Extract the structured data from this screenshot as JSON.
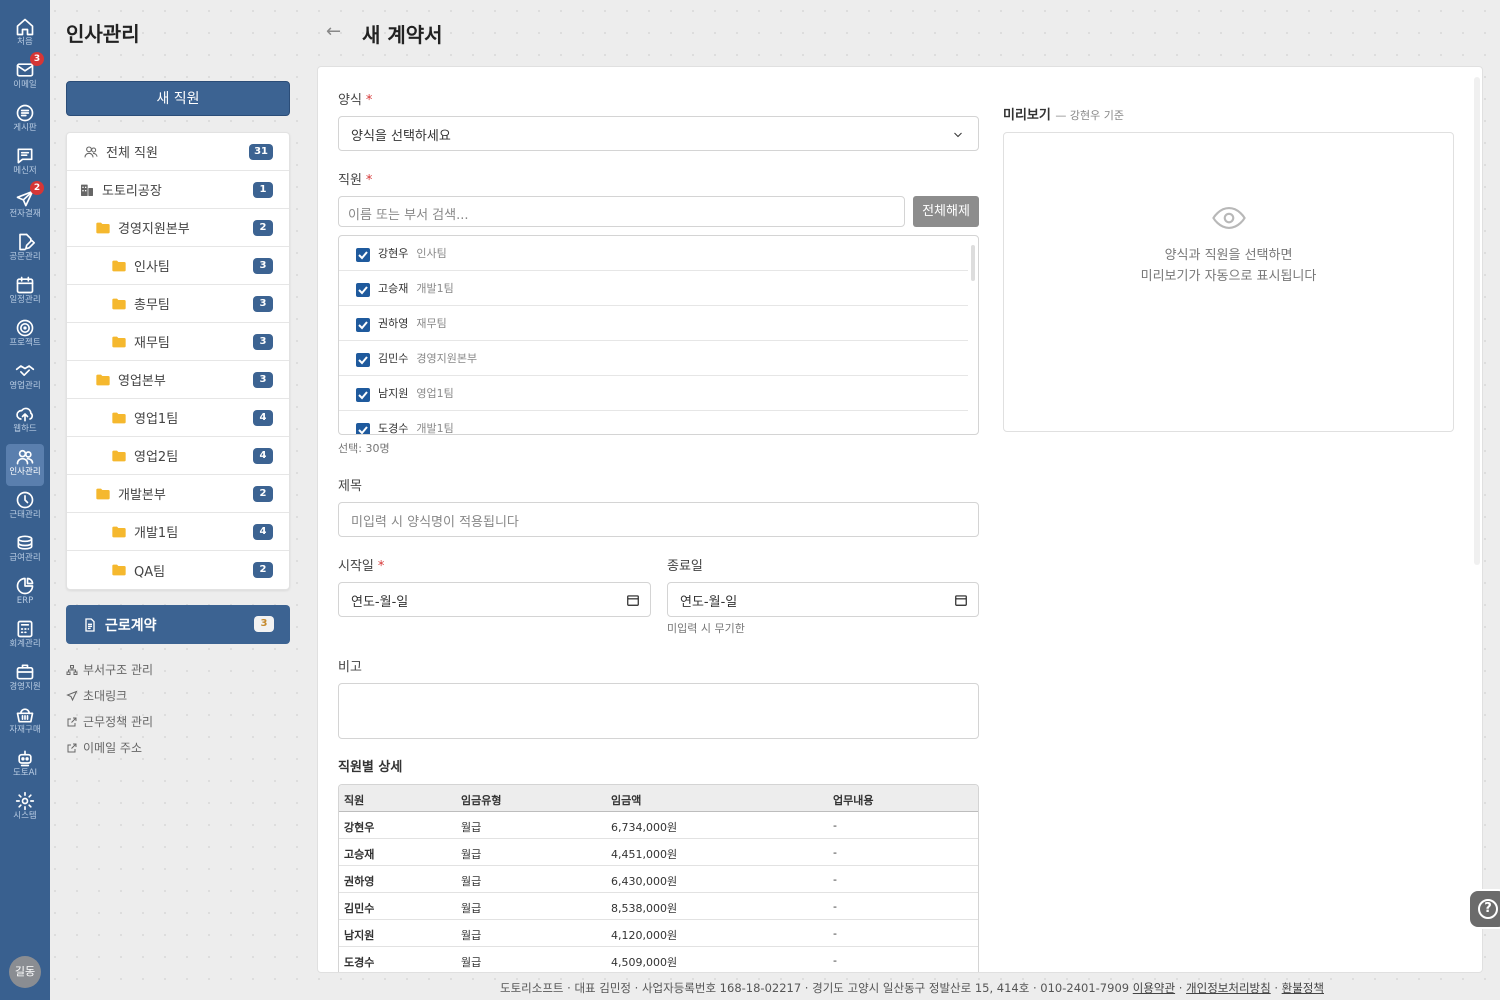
{
  "rail": [
    {
      "label": "처음",
      "icon": "home-icon",
      "badge": ""
    },
    {
      "label": "이메일",
      "icon": "mail-icon",
      "badge": "3"
    },
    {
      "label": "게시판",
      "icon": "board-icon",
      "badge": ""
    },
    {
      "label": "메신저",
      "icon": "chat-icon",
      "badge": ""
    },
    {
      "label": "전자결재",
      "icon": "send-icon",
      "badge": "2"
    },
    {
      "label": "공문관리",
      "icon": "document-edit-icon",
      "badge": ""
    },
    {
      "label": "일정관리",
      "icon": "calendar-icon",
      "badge": ""
    },
    {
      "label": "프로젝트",
      "icon": "target-icon",
      "badge": ""
    },
    {
      "label": "영업관리",
      "icon": "handshake-icon",
      "badge": ""
    },
    {
      "label": "웹하드",
      "icon": "cloud-upload-icon",
      "badge": ""
    },
    {
      "label": "인사관리",
      "icon": "users-icon",
      "badge": ""
    },
    {
      "label": "근태관리",
      "icon": "clock-icon",
      "badge": ""
    },
    {
      "label": "급여관리",
      "icon": "coins-icon",
      "badge": ""
    },
    {
      "label": "ERP",
      "icon": "pie-chart-icon",
      "badge": ""
    },
    {
      "label": "회계관리",
      "icon": "calculator-icon",
      "badge": ""
    },
    {
      "label": "경영지원",
      "icon": "briefcase-icon",
      "badge": ""
    },
    {
      "label": "자재구매",
      "icon": "basket-icon",
      "badge": ""
    },
    {
      "label": "도토AI",
      "icon": "robot-icon",
      "badge": ""
    },
    {
      "label": "시스템",
      "icon": "gear-icon",
      "badge": ""
    }
  ],
  "user": {
    "avatar": "길동"
  },
  "sidebar": {
    "title": "인사관리",
    "new_button": "새 직원",
    "tree": [
      {
        "label": "전체 직원",
        "count": "31",
        "icon": "users-icon",
        "level": 0
      },
      {
        "label": "도토리공장",
        "count": "1",
        "icon": "building-icon",
        "level": 0
      },
      {
        "label": "경영지원본부",
        "count": "2",
        "icon": "folder-icon",
        "level": 1
      },
      {
        "label": "인사팀",
        "count": "3",
        "icon": "folder-icon",
        "level": 2
      },
      {
        "label": "총무팀",
        "count": "3",
        "icon": "folder-icon",
        "level": 2
      },
      {
        "label": "재무팀",
        "count": "3",
        "icon": "folder-icon",
        "level": 2
      },
      {
        "label": "영업본부",
        "count": "3",
        "icon": "folder-icon",
        "level": 1
      },
      {
        "label": "영업1팀",
        "count": "4",
        "icon": "folder-icon",
        "level": 2
      },
      {
        "label": "영업2팀",
        "count": "4",
        "icon": "folder-icon",
        "level": 2
      },
      {
        "label": "개발본부",
        "count": "2",
        "icon": "folder-icon",
        "level": 1
      },
      {
        "label": "개발1팀",
        "count": "4",
        "icon": "folder-icon",
        "level": 2
      },
      {
        "label": "QA팀",
        "count": "2",
        "icon": "folder-icon",
        "level": 2
      }
    ],
    "contract": {
      "label": "근로계약",
      "count": "3"
    },
    "links": [
      {
        "label": "부서구조 관리",
        "icon": "org-chart-icon"
      },
      {
        "label": "초대링크",
        "icon": "send-icon"
      },
      {
        "label": "근무정책 관리",
        "icon": "external-link-icon"
      },
      {
        "label": "이메일 주소",
        "icon": "external-link-icon"
      }
    ]
  },
  "page": {
    "back": "←",
    "title": "새 계약서"
  },
  "form": {
    "template_label": "양식",
    "template_value": "양식을 선택하세요",
    "employee_label": "직원",
    "search_placeholder": "이름 또는 부서 검색...",
    "clear_button": "전체해제",
    "employees": [
      {
        "name": "강현우",
        "dept": "인사팀",
        "checked": true
      },
      {
        "name": "고승재",
        "dept": "개발1팀",
        "checked": true
      },
      {
        "name": "권하영",
        "dept": "재무팀",
        "checked": true
      },
      {
        "name": "김민수",
        "dept": "경영지원본부",
        "checked": true
      },
      {
        "name": "남지원",
        "dept": "영업1팀",
        "checked": true
      },
      {
        "name": "도경수",
        "dept": "개발1팀",
        "checked": true
      }
    ],
    "selected_count": "선택: 30명",
    "subject_label": "제목",
    "subject_placeholder": "미입력 시 양식명이 적용됩니다",
    "start_label": "시작일",
    "start_value": "연도-월-일",
    "end_label": "종료일",
    "end_value": "연도-월-일",
    "end_note": "미입력 시 무기한",
    "remark_label": "비고",
    "details_title": "직원별 상세",
    "table_headers": [
      "직원",
      "임금유형",
      "임금액",
      "업무내용"
    ],
    "table_rows": [
      [
        "강현우",
        "월급",
        "6,734,000원",
        "-"
      ],
      [
        "고승재",
        "월급",
        "4,451,000원",
        "-"
      ],
      [
        "권하영",
        "월급",
        "6,430,000원",
        "-"
      ],
      [
        "김민수",
        "월급",
        "8,538,000원",
        "-"
      ],
      [
        "남지원",
        "월급",
        "4,120,000원",
        "-"
      ],
      [
        "도경수",
        "월급",
        "4,509,000원",
        "-"
      ]
    ]
  },
  "preview": {
    "title": "미리보기",
    "subtitle": "— 강현우 기준",
    "message_line1": "양식과 직원을 선택하면",
    "message_line2": "미리보기가 자동으로 표시됩니다"
  },
  "footer": {
    "text": "도토리소프트 · 대표 김민정 · 사업자등록번호 168-18-02217 · 경기도 고양시 일산동구 정발산로 15, 414호 · 010-2401-7909",
    "terms": "이용약관",
    "privacy": "개인정보처리방침",
    "refund": "환불정책",
    "sep": "·"
  },
  "colors": {
    "rail": "#39608f",
    "primary": "#3c6392",
    "badge": "#d63636",
    "folder": "#f5b82e"
  }
}
